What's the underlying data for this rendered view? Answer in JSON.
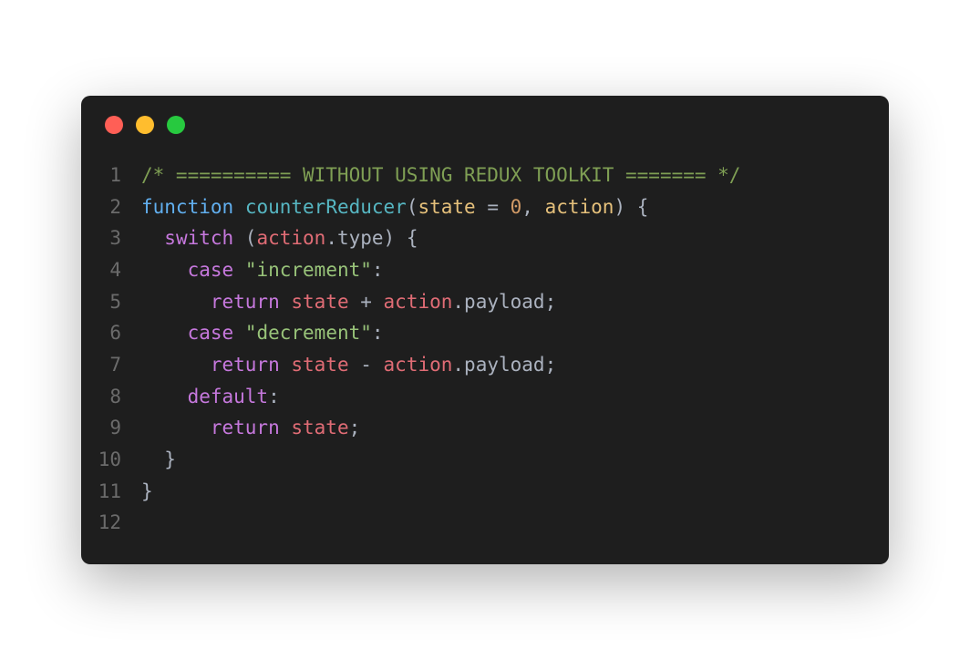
{
  "window": {
    "traffic_lights": [
      "close",
      "minimize",
      "zoom"
    ]
  },
  "colors": {
    "background": "#1e1e1e",
    "red": "#ff5f56",
    "yellow": "#ffbd2e",
    "green": "#27c93f"
  },
  "code": {
    "language": "javascript",
    "lines": [
      {
        "n": "1",
        "tokens": [
          {
            "t": "/* ========== WITHOUT USING REDUX TOOLKIT ======= */",
            "c": "tok-comment"
          }
        ]
      },
      {
        "n": "2",
        "tokens": [
          {
            "t": "function",
            "c": "tok-fnkeyword"
          },
          {
            "t": " ",
            "c": "tok-punct"
          },
          {
            "t": "counterReducer",
            "c": "tok-fnname"
          },
          {
            "t": "(",
            "c": "tok-punct"
          },
          {
            "t": "state",
            "c": "tok-param"
          },
          {
            "t": " = ",
            "c": "tok-punct"
          },
          {
            "t": "0",
            "c": "tok-number"
          },
          {
            "t": ", ",
            "c": "tok-punct"
          },
          {
            "t": "action",
            "c": "tok-param"
          },
          {
            "t": ") {",
            "c": "tok-punct"
          }
        ]
      },
      {
        "n": "3",
        "tokens": [
          {
            "t": "  ",
            "c": "tok-punct"
          },
          {
            "t": "switch",
            "c": "tok-keyword"
          },
          {
            "t": " (",
            "c": "tok-punct"
          },
          {
            "t": "action",
            "c": "tok-ident"
          },
          {
            "t": ".",
            "c": "tok-punct"
          },
          {
            "t": "type",
            "c": "tok-prop"
          },
          {
            "t": ") {",
            "c": "tok-punct"
          }
        ]
      },
      {
        "n": "4",
        "tokens": [
          {
            "t": "    ",
            "c": "tok-punct"
          },
          {
            "t": "case",
            "c": "tok-keyword"
          },
          {
            "t": " ",
            "c": "tok-punct"
          },
          {
            "t": "\"increment\"",
            "c": "tok-string"
          },
          {
            "t": ":",
            "c": "tok-punct"
          }
        ]
      },
      {
        "n": "5",
        "tokens": [
          {
            "t": "      ",
            "c": "tok-punct"
          },
          {
            "t": "return",
            "c": "tok-keyword"
          },
          {
            "t": " ",
            "c": "tok-punct"
          },
          {
            "t": "state",
            "c": "tok-ident"
          },
          {
            "t": " + ",
            "c": "tok-punct"
          },
          {
            "t": "action",
            "c": "tok-ident"
          },
          {
            "t": ".",
            "c": "tok-punct"
          },
          {
            "t": "payload",
            "c": "tok-prop"
          },
          {
            "t": ";",
            "c": "tok-punct"
          }
        ]
      },
      {
        "n": "6",
        "tokens": [
          {
            "t": "    ",
            "c": "tok-punct"
          },
          {
            "t": "case",
            "c": "tok-keyword"
          },
          {
            "t": " ",
            "c": "tok-punct"
          },
          {
            "t": "\"decrement\"",
            "c": "tok-string"
          },
          {
            "t": ":",
            "c": "tok-punct"
          }
        ]
      },
      {
        "n": "7",
        "tokens": [
          {
            "t": "      ",
            "c": "tok-punct"
          },
          {
            "t": "return",
            "c": "tok-keyword"
          },
          {
            "t": " ",
            "c": "tok-punct"
          },
          {
            "t": "state",
            "c": "tok-ident"
          },
          {
            "t": " - ",
            "c": "tok-punct"
          },
          {
            "t": "action",
            "c": "tok-ident"
          },
          {
            "t": ".",
            "c": "tok-punct"
          },
          {
            "t": "payload",
            "c": "tok-prop"
          },
          {
            "t": ";",
            "c": "tok-punct"
          }
        ]
      },
      {
        "n": "8",
        "tokens": [
          {
            "t": "    ",
            "c": "tok-punct"
          },
          {
            "t": "default",
            "c": "tok-keyword"
          },
          {
            "t": ":",
            "c": "tok-punct"
          }
        ]
      },
      {
        "n": "9",
        "tokens": [
          {
            "t": "      ",
            "c": "tok-punct"
          },
          {
            "t": "return",
            "c": "tok-keyword"
          },
          {
            "t": " ",
            "c": "tok-punct"
          },
          {
            "t": "state",
            "c": "tok-ident"
          },
          {
            "t": ";",
            "c": "tok-punct"
          }
        ]
      },
      {
        "n": "10",
        "tokens": [
          {
            "t": "  }",
            "c": "tok-punct"
          }
        ]
      },
      {
        "n": "11",
        "tokens": [
          {
            "t": "}",
            "c": "tok-punct"
          }
        ]
      },
      {
        "n": "12",
        "tokens": []
      }
    ]
  }
}
